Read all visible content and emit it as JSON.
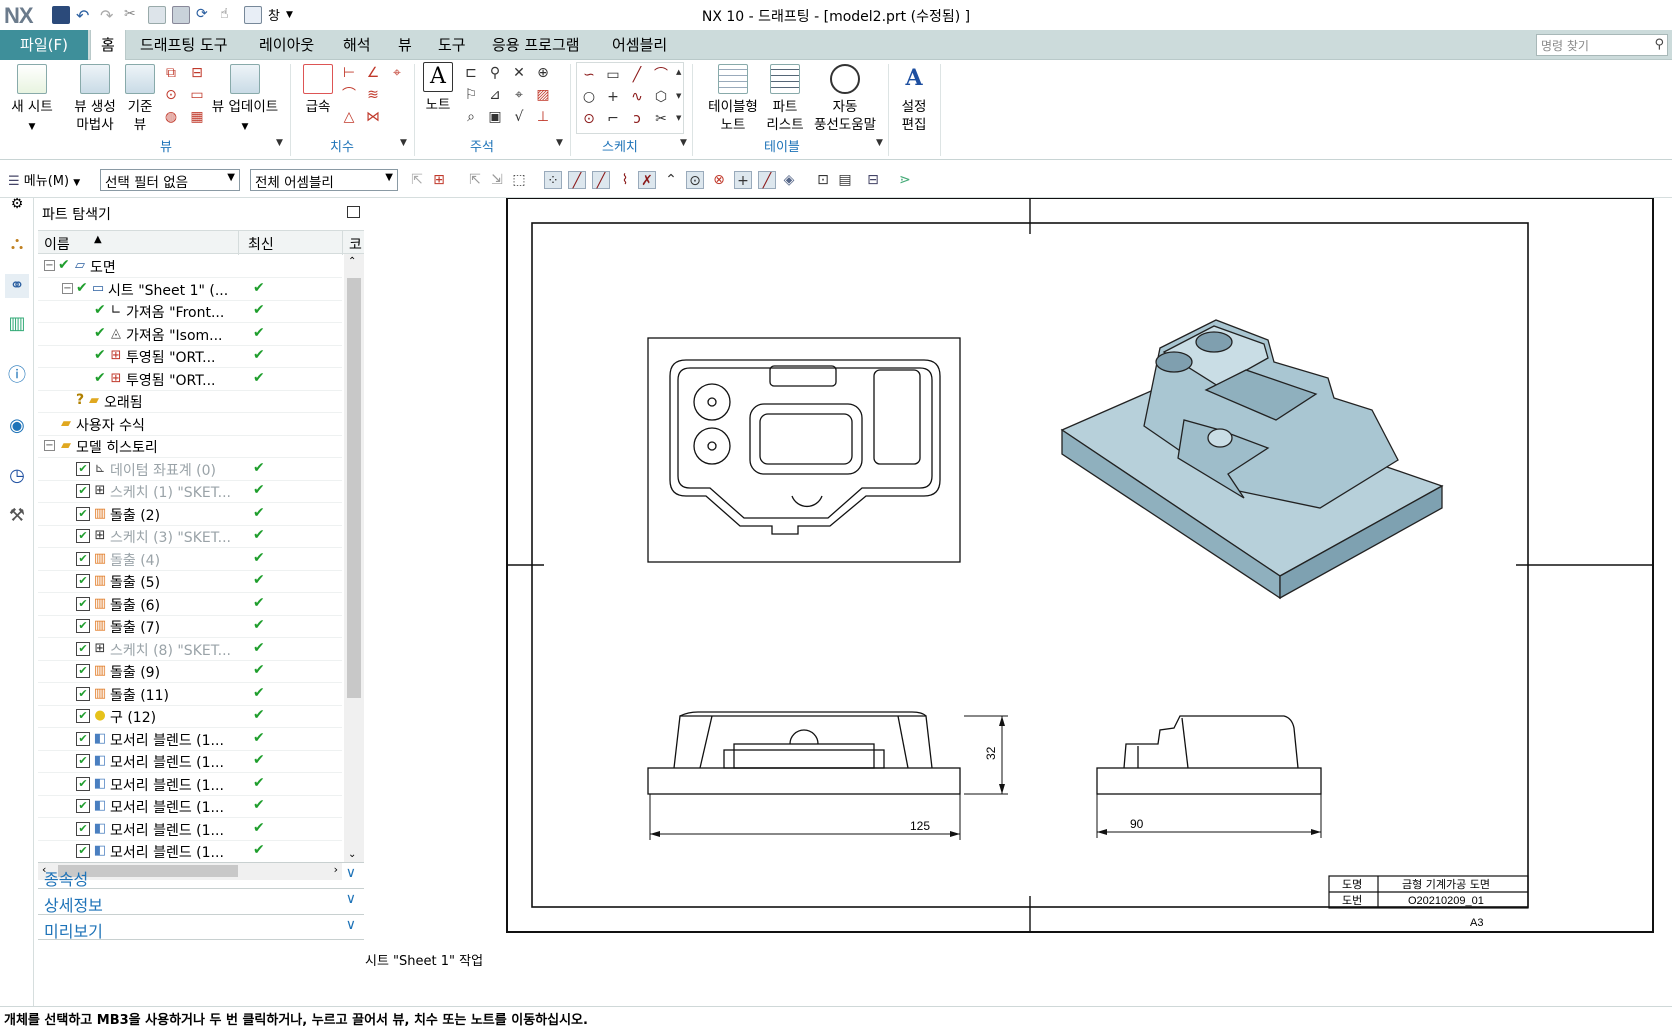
{
  "app": {
    "logo": "NX",
    "window_title": "NX 10 - 드래프팅 - [model2.prt (수정됨) ]",
    "qat_window_label": "창"
  },
  "tabs": {
    "file": "파일(F)",
    "items": [
      "홈",
      "드래프팅 도구",
      "레이아웃",
      "해석",
      "뷰",
      "도구",
      "응용 프로그램",
      "어셈블리"
    ],
    "active": "홈"
  },
  "command_finder": {
    "placeholder": "명령 찾기"
  },
  "ribbon": {
    "new_sheet": "새 시트",
    "view_wizard_l1": "뷰 생성",
    "view_wizard_l2": "마법사",
    "base_view_l1": "기준",
    "base_view_l2": "뷰",
    "view_update": "뷰 업데이트",
    "group_view": "뷰",
    "rapid": "급속",
    "group_dimension": "치수",
    "note": "노트",
    "group_annotation": "주석",
    "group_sketch": "스케치",
    "tabular_l1": "테이블형",
    "tabular_l2": "노트",
    "parts_list_l1": "파트",
    "parts_list_l2": "리스트",
    "auto_balloon_l1": "자동",
    "auto_balloon_l2": "풍선도움말",
    "group_table": "테이블",
    "settings_l1": "설정",
    "settings_l2": "편집"
  },
  "toolbar": {
    "menu": "메뉴(M)",
    "selection_filter": "선택 필터 없음",
    "scope": "전체 어셈블리"
  },
  "navigator": {
    "title": "파트 탐색기",
    "col_name": "이름",
    "col_latest": "최신",
    "col_code": "코",
    "rows": [
      {
        "label": "도면",
        "indent": 0,
        "exp": "−",
        "check": true,
        "icon": "drawing",
        "latest": false,
        "gray": false
      },
      {
        "label": "시트 \"Sheet 1\" (...",
        "indent": 1,
        "exp": "−",
        "check": true,
        "icon": "sheet",
        "latest": true,
        "gray": false
      },
      {
        "label": "가져옴 \"Front...",
        "indent": 2,
        "exp": "",
        "check": true,
        "icon": "view",
        "latest": true,
        "gray": false
      },
      {
        "label": "가져옴 \"Isom...",
        "indent": 2,
        "exp": "",
        "check": true,
        "icon": "iso",
        "latest": true,
        "gray": false
      },
      {
        "label": "투영됨 \"ORT...",
        "indent": 2,
        "exp": "",
        "check": true,
        "icon": "proj",
        "latest": true,
        "gray": false
      },
      {
        "label": "투영됨 \"ORT...",
        "indent": 2,
        "exp": "",
        "check": true,
        "icon": "proj",
        "latest": true,
        "gray": false
      },
      {
        "label": "오래됨",
        "indent": 1,
        "exp": "",
        "check": false,
        "icon": "folder-q",
        "latest": false,
        "gray": false
      },
      {
        "label": "사용자 수식",
        "indent": 0,
        "exp": "",
        "check": false,
        "icon": "folder",
        "latest": false,
        "gray": false
      },
      {
        "label": "모델 히스토리",
        "indent": 0,
        "exp": "−",
        "check": false,
        "icon": "folder",
        "latest": false,
        "gray": false
      },
      {
        "label": "데이텀 좌표계 (0)",
        "indent": 1,
        "exp": "",
        "box": true,
        "icon": "datum",
        "latest": true,
        "gray": true
      },
      {
        "label": "스케치 (1) \"SKET...",
        "indent": 1,
        "exp": "",
        "box": true,
        "icon": "sketch",
        "latest": true,
        "gray": true
      },
      {
        "label": "돌출 (2)",
        "indent": 1,
        "exp": "",
        "box": true,
        "icon": "extrude",
        "latest": true,
        "gray": false
      },
      {
        "label": "스케치 (3) \"SKET...",
        "indent": 1,
        "exp": "",
        "box": true,
        "icon": "sketch",
        "latest": true,
        "gray": true
      },
      {
        "label": "돌출 (4)",
        "indent": 1,
        "exp": "",
        "box": true,
        "icon": "extrude",
        "latest": true,
        "gray": true
      },
      {
        "label": "돌출 (5)",
        "indent": 1,
        "exp": "",
        "box": true,
        "icon": "extrude",
        "latest": true,
        "gray": false
      },
      {
        "label": "돌출 (6)",
        "indent": 1,
        "exp": "",
        "box": true,
        "icon": "extrude",
        "latest": true,
        "gray": false
      },
      {
        "label": "돌출 (7)",
        "indent": 1,
        "exp": "",
        "box": true,
        "icon": "extrude",
        "latest": true,
        "gray": false
      },
      {
        "label": "스케치 (8) \"SKET...",
        "indent": 1,
        "exp": "",
        "box": true,
        "icon": "sketch",
        "latest": true,
        "gray": true
      },
      {
        "label": "돌출 (9)",
        "indent": 1,
        "exp": "",
        "box": true,
        "icon": "extrude",
        "latest": true,
        "gray": false
      },
      {
        "label": "돌출 (11)",
        "indent": 1,
        "exp": "",
        "box": true,
        "icon": "extrude",
        "latest": true,
        "gray": false
      },
      {
        "label": "구 (12)",
        "indent": 1,
        "exp": "",
        "box": true,
        "icon": "sphere",
        "latest": true,
        "gray": false
      },
      {
        "label": "모서리 블렌드 (1...",
        "indent": 1,
        "exp": "",
        "box": true,
        "icon": "blend",
        "latest": true,
        "gray": false
      },
      {
        "label": "모서리 블렌드 (1...",
        "indent": 1,
        "exp": "",
        "box": true,
        "icon": "blend",
        "latest": true,
        "gray": false
      },
      {
        "label": "모서리 블렌드 (1...",
        "indent": 1,
        "exp": "",
        "box": true,
        "icon": "blend",
        "latest": true,
        "gray": false
      },
      {
        "label": "모서리 블렌드 (1...",
        "indent": 1,
        "exp": "",
        "box": true,
        "icon": "blend",
        "latest": true,
        "gray": false
      },
      {
        "label": "모서리 블렌드 (1...",
        "indent": 1,
        "exp": "",
        "box": true,
        "icon": "blend",
        "latest": true,
        "gray": false
      },
      {
        "label": "모서리 블렌드 (1...",
        "indent": 1,
        "exp": "",
        "box": true,
        "icon": "blend",
        "latest": true,
        "gray": false
      }
    ],
    "panels": [
      "종속성",
      "상세정보",
      "미리보기"
    ]
  },
  "drawing": {
    "dim_height": "32",
    "dim_width_front": "125",
    "dim_width_side": "90",
    "title_block": {
      "label_name": "도명",
      "value_name": "금형 기계가공 도면",
      "label_number": "도번",
      "value_number": "O20210209_01",
      "size": "A3"
    },
    "sheet_status": "시트 \"Sheet 1\" 작업"
  },
  "status_bar": {
    "message": "개체를 선택하고 MB3을 사용하거나 두 번 클릭하거나, 누르고 끌어서 뷰, 치수 또는 노트를 이동하십시오."
  }
}
